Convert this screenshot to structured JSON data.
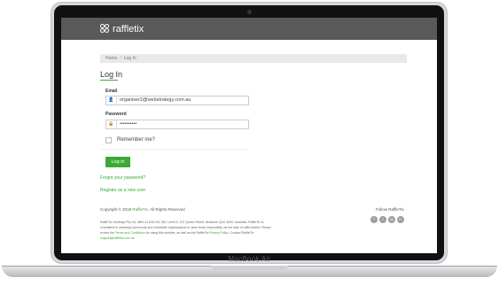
{
  "device": {
    "label": "MacBook Air"
  },
  "header": {
    "brand": "raffletix"
  },
  "breadcrumb": {
    "home": "Home",
    "current": "Log In"
  },
  "page": {
    "title": "Log In"
  },
  "form": {
    "email_label": "Email",
    "email_value": "organiser2@webstrategy.com.au",
    "password_label": "Password",
    "password_value": "••••••••••",
    "remember_label": "Remember me?",
    "login_button": "Log in"
  },
  "links": {
    "forgot": "Forgot your password?",
    "register": "Register as a new user"
  },
  "footer": {
    "copyright_prefix": "Copyright © 2019 ",
    "copyright_brand": "RaffleTix",
    "copyright_suffix": ". All Rights Reserved",
    "follow": "Follow RaffleTix",
    "legal_1": "RaffleTix Holdings Pty Ltd, ABN 24 625 031 340, Level 5, 102 Queen Street, Brisbane QLD 4000, Australia. RaffleTix is",
    "legal_2": "committed to assisting community and charitable organisations to raise funds responsibly via the sale of raffle tickets. Please",
    "legal_3_prefix": "review the ",
    "legal_3_terms": "Terms and Conditions",
    "legal_3_mid": " for using this website, as well as the RaffleTix ",
    "legal_3_privacy": "Privacy Policy",
    "legal_3_suffix": ". Contact RaffleTix",
    "support_email": "support@raffletix.com.au",
    "social": [
      "f",
      "t",
      "ig",
      "in"
    ]
  },
  "colors": {
    "brand_green": "#3aaa35",
    "header_gray": "#58595b"
  }
}
